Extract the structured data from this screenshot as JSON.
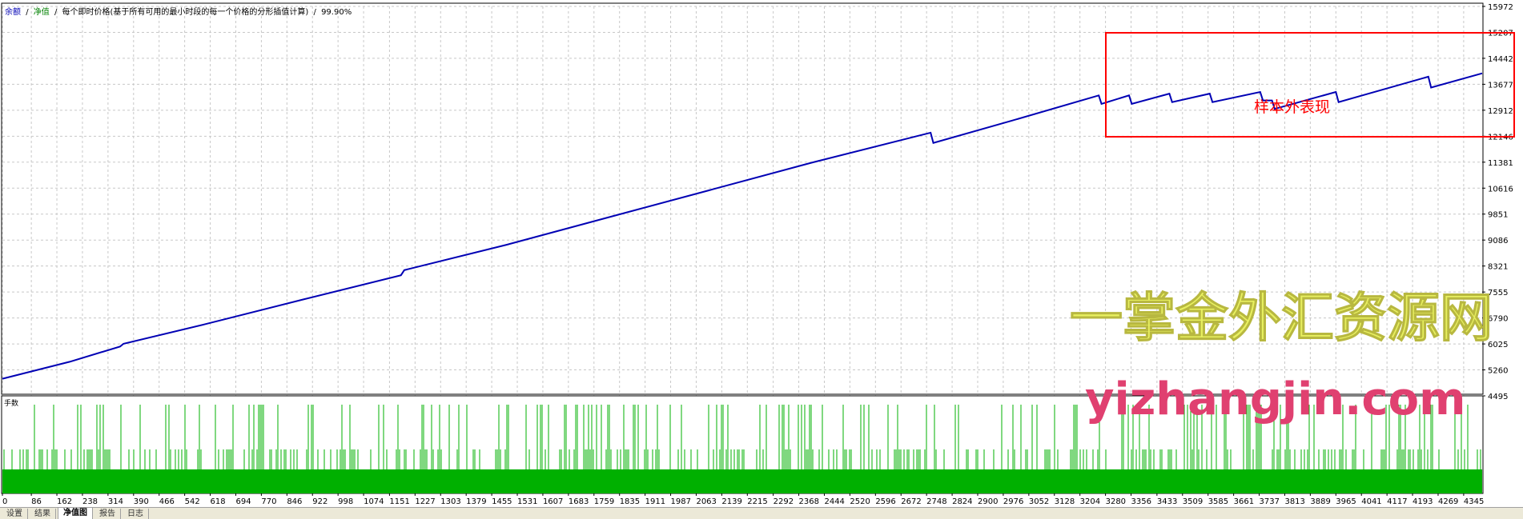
{
  "header": {
    "legend_balance": "余额",
    "legend_sep1": "/",
    "legend_equity": "净值",
    "legend_sep2": "/",
    "model_text": "每个即时价格(基于所有可用的最小时段的每一个价格的分形插值计算)",
    "sep3": "/",
    "quality": "99.90%"
  },
  "lower_panel": {
    "label": "手数"
  },
  "annotation": {
    "text": "样本外表现",
    "color": "#ff0000"
  },
  "watermark": {
    "line1": "一掌金外汇资源网",
    "line2": "yizhangjin.com",
    "line1_color": "#e8f060",
    "line2_color": "#e04070"
  },
  "tabs": [
    {
      "label": "设置",
      "active": false
    },
    {
      "label": "结果",
      "active": false
    },
    {
      "label": "净值图",
      "active": true
    },
    {
      "label": "报告",
      "active": false
    },
    {
      "label": "日志",
      "active": false
    }
  ],
  "colors": {
    "equity_line": "#0000b4",
    "lots_bars": "#00b000",
    "grid": "#c8c8c8",
    "axis_text": "#000000"
  },
  "chart_data": {
    "type": "line",
    "title": "",
    "xlabel": "",
    "ylabel": "",
    "xlim": [
      0,
      4400
    ],
    "ylim": [
      4495,
      15972
    ],
    "yticks": [
      15972,
      15207,
      14442,
      13677,
      12912,
      12146,
      11381,
      10616,
      9851,
      9086,
      8321,
      7555,
      6790,
      6025,
      5260,
      4495
    ],
    "xticks": [
      0,
      86,
      162,
      238,
      314,
      390,
      466,
      542,
      618,
      694,
      770,
      846,
      922,
      998,
      1074,
      1151,
      1227,
      1303,
      1379,
      1455,
      1531,
      1607,
      1683,
      1759,
      1835,
      1911,
      1987,
      2063,
      2139,
      2215,
      2292,
      2368,
      2444,
      2520,
      2596,
      2672,
      2748,
      2824,
      2900,
      2976,
      3052,
      3128,
      3204,
      3280,
      3356,
      3433,
      3509,
      3585,
      3661,
      3737,
      3813,
      3889,
      3965,
      4041,
      4117,
      4193,
      4269,
      4345
    ],
    "grid": true,
    "series": [
      {
        "color": "#0000b4",
        "points": [
          [
            0,
            5000
          ],
          [
            200,
            5500
          ],
          [
            350,
            5950
          ],
          [
            360,
            6030
          ],
          [
            600,
            6600
          ],
          [
            900,
            7350
          ],
          [
            1185,
            8050
          ],
          [
            1195,
            8200
          ],
          [
            1500,
            8950
          ],
          [
            1800,
            9750
          ],
          [
            2100,
            10550
          ],
          [
            2400,
            11350
          ],
          [
            2760,
            12250
          ],
          [
            2768,
            11950
          ],
          [
            3000,
            12600
          ],
          [
            3260,
            13350
          ],
          [
            3268,
            13100
          ],
          [
            3350,
            13350
          ],
          [
            3358,
            13100
          ],
          [
            3470,
            13400
          ],
          [
            3478,
            13150
          ],
          [
            3590,
            13400
          ],
          [
            3598,
            13150
          ],
          [
            3740,
            13450
          ],
          [
            3748,
            13200
          ],
          [
            3775,
            13200
          ],
          [
            3783,
            12950
          ],
          [
            3965,
            13450
          ],
          [
            3973,
            13150
          ],
          [
            4240,
            13900
          ],
          [
            4248,
            13580
          ],
          [
            4400,
            14000
          ]
        ]
      }
    ],
    "lower": {
      "type": "bar",
      "label": "手数",
      "base_level": 1,
      "levels": [
        1,
        2,
        3
      ],
      "color": "#00b000"
    }
  }
}
